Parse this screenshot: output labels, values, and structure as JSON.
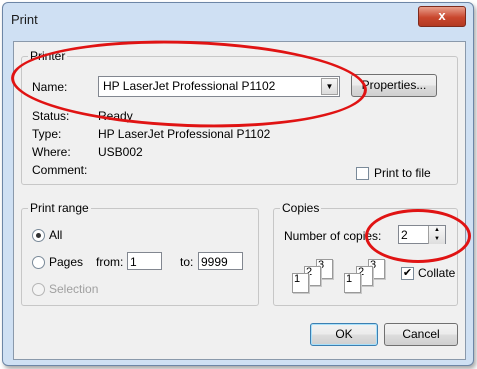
{
  "window": {
    "title": "Print",
    "close_glyph": "x"
  },
  "printer": {
    "legend": "Printer",
    "name_label": "Name:",
    "name_value": "HP LaserJet Professional P1102",
    "properties_label": "Properties...",
    "status_label": "Status:",
    "status_value": "Ready",
    "type_label": "Type:",
    "type_value": "HP LaserJet Professional P1102",
    "where_label": "Where:",
    "where_value": "USB002",
    "comment_label": "Comment:",
    "print_to_file_label": "Print to file"
  },
  "print_range": {
    "legend": "Print range",
    "all_label": "All",
    "pages_label": "Pages",
    "from_label": "from:",
    "from_value": "1",
    "to_label": "to:",
    "to_value": "9999",
    "selection_label": "Selection"
  },
  "copies": {
    "legend": "Copies",
    "number_label": "Number of copies:",
    "number_value": "2",
    "collate_label": "Collate",
    "collate_checked": "✔",
    "stack1": [
      "1",
      "2",
      "3"
    ],
    "stack2": [
      "1",
      "2",
      "3"
    ]
  },
  "buttons": {
    "ok": "OK",
    "cancel": "Cancel"
  },
  "icons": {
    "combo_arrow": "▼",
    "spin_up": "▲",
    "spin_down": "▼"
  },
  "colors": {
    "annotation": "#e01313",
    "title_bar": "#cfe0f3"
  }
}
